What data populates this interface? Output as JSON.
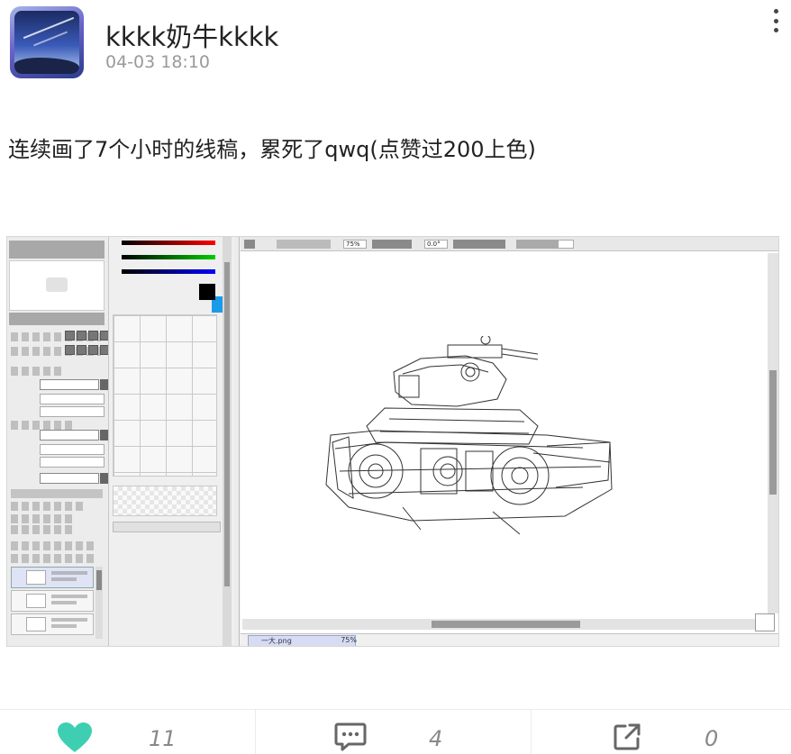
{
  "post": {
    "username": "kkkk奶牛kkkk",
    "timestamp": "04-03 18:10",
    "text": "连续画了7个小时的线稿，累死了qwq(点赞过200上色)"
  },
  "screenshot": {
    "zoom_label": "75%",
    "angle_label": "0.0°",
    "file_name": "一大.png",
    "file_zoom": "75%"
  },
  "actions": {
    "likes": "11",
    "comments": "4",
    "shares": "0"
  },
  "colors": {
    "like_icon": "#3ecfb2",
    "count_text": "#888888"
  },
  "icons": {
    "more": "more-vertical-icon",
    "like": "heart-icon",
    "comment": "comment-icon",
    "share": "share-icon"
  }
}
